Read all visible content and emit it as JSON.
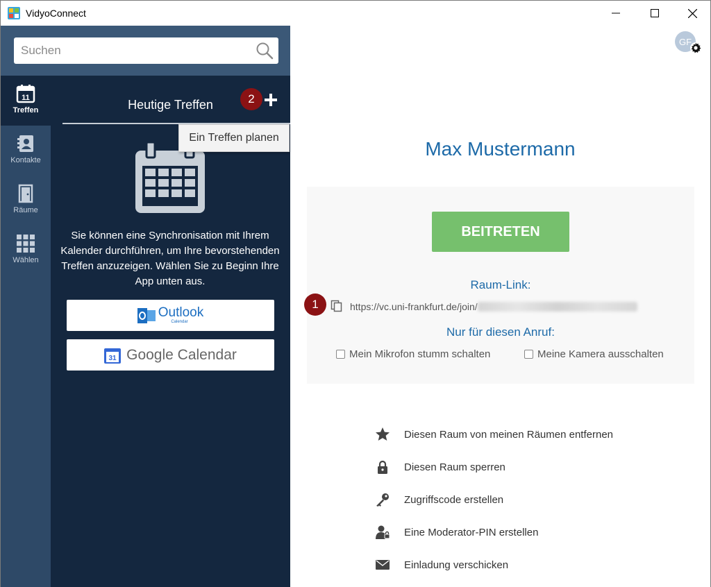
{
  "window": {
    "title": "VidyoConnect"
  },
  "search": {
    "placeholder": "Suchen"
  },
  "nav": [
    {
      "label": "Treffen",
      "icon": "calendar-icon",
      "active": true
    },
    {
      "label": "Kontakte",
      "icon": "contacts-icon",
      "active": false
    },
    {
      "label": "Räume",
      "icon": "door-icon",
      "active": false
    },
    {
      "label": "Wählen",
      "icon": "dialpad-icon",
      "active": false
    }
  ],
  "meetings": {
    "title": "Heutige Treffen",
    "add_tooltip": "Ein Treffen planen",
    "sync_text": "Sie können eine Synchronisation mit Ihrem Kalender durchführen, um Ihre bevorstehenden Treffen anzuzeigen. Wählen Sie zu Beginn Ihre App unten aus.",
    "outlook_label": "Outlook",
    "outlook_sublabel": "Calendar",
    "google_label": "Google Calendar",
    "google_icon_day": "31"
  },
  "annotations": {
    "badge1": "1",
    "badge2": "2"
  },
  "user": {
    "initials": "GF"
  },
  "room": {
    "name": "Max Mustermann",
    "join_label": "BEITRETEN",
    "link_label": "Raum-Link:",
    "link_url": "https://vc.uni-frankfurt.de/join/",
    "call_label": "Nur für diesen Anruf:",
    "mute_mic_label": "Mein Mikrofon stumm schalten",
    "camera_off_label": "Meine Kamera ausschalten"
  },
  "actions": [
    {
      "label": "Diesen Raum von meinen Räumen entfernen",
      "icon": "star-icon"
    },
    {
      "label": "Diesen Raum sperren",
      "icon": "lock-icon"
    },
    {
      "label": "Zugriffscode erstellen",
      "icon": "key-icon"
    },
    {
      "label": "Eine Moderator-PIN erstellen",
      "icon": "moderator-icon"
    },
    {
      "label": "Einladung verschicken",
      "icon": "mail-icon"
    }
  ],
  "colors": {
    "sidebar_dark": "#14273f",
    "sidebar_rail": "#2e4967",
    "search_band": "#3b5877",
    "accent_blue": "#1d6aa8",
    "join_green": "#76c06d",
    "badge_red": "#8b1214"
  }
}
